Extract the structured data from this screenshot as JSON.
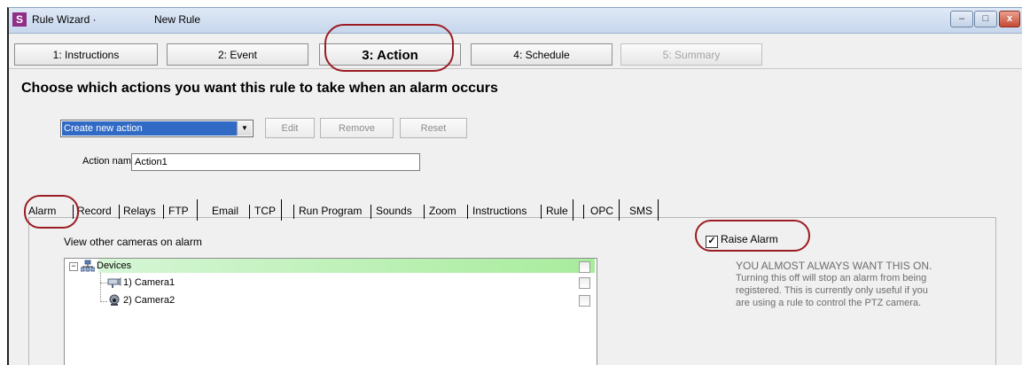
{
  "window": {
    "app_icon_letter": "S",
    "title": "Rule Wizard ·",
    "subtitle": "New Rule",
    "buttons": {
      "minimize": "–",
      "maximize": "□",
      "close": "x"
    }
  },
  "steps": [
    {
      "label": "1: Instructions"
    },
    {
      "label": "2: Event"
    },
    {
      "label": "3: Action"
    },
    {
      "label": "4: Schedule"
    },
    {
      "label": "5: Summary"
    }
  ],
  "main": {
    "heading": "Choose which actions you want this rule to take when an alarm occurs",
    "action_select": {
      "value": "Create new action"
    },
    "buttons": {
      "edit": "Edit",
      "remove": "Remove",
      "reset": "Reset"
    },
    "action_name": {
      "label": "Action name",
      "value": "Action1"
    }
  },
  "tabs": [
    "Alarm",
    "Record",
    "Relays",
    "FTP",
    "Email",
    "TCP",
    "Run Program",
    "Sounds",
    "Zoom",
    "Instructions",
    "Rule",
    "OPC",
    "SMS"
  ],
  "alarm_panel": {
    "view_label": "View other cameras on alarm",
    "tree": {
      "root": "Devices",
      "items": [
        "1) Camera1",
        "2) Camera2"
      ]
    },
    "raise_alarm": {
      "label": "Raise Alarm",
      "checked": true,
      "check_glyph": "✓"
    },
    "info_lines": [
      "YOU ALMOST ALWAYS WANT THIS ON.",
      "Turning this off will stop an alarm from being",
      "registered.  This is currently only useful if you",
      "are using a rule to control the PTZ camera."
    ]
  },
  "colors": {
    "highlight_ring": "#9b1c22",
    "selection": "#316ac5",
    "tree_row_highlight": "#a8ec9c"
  }
}
